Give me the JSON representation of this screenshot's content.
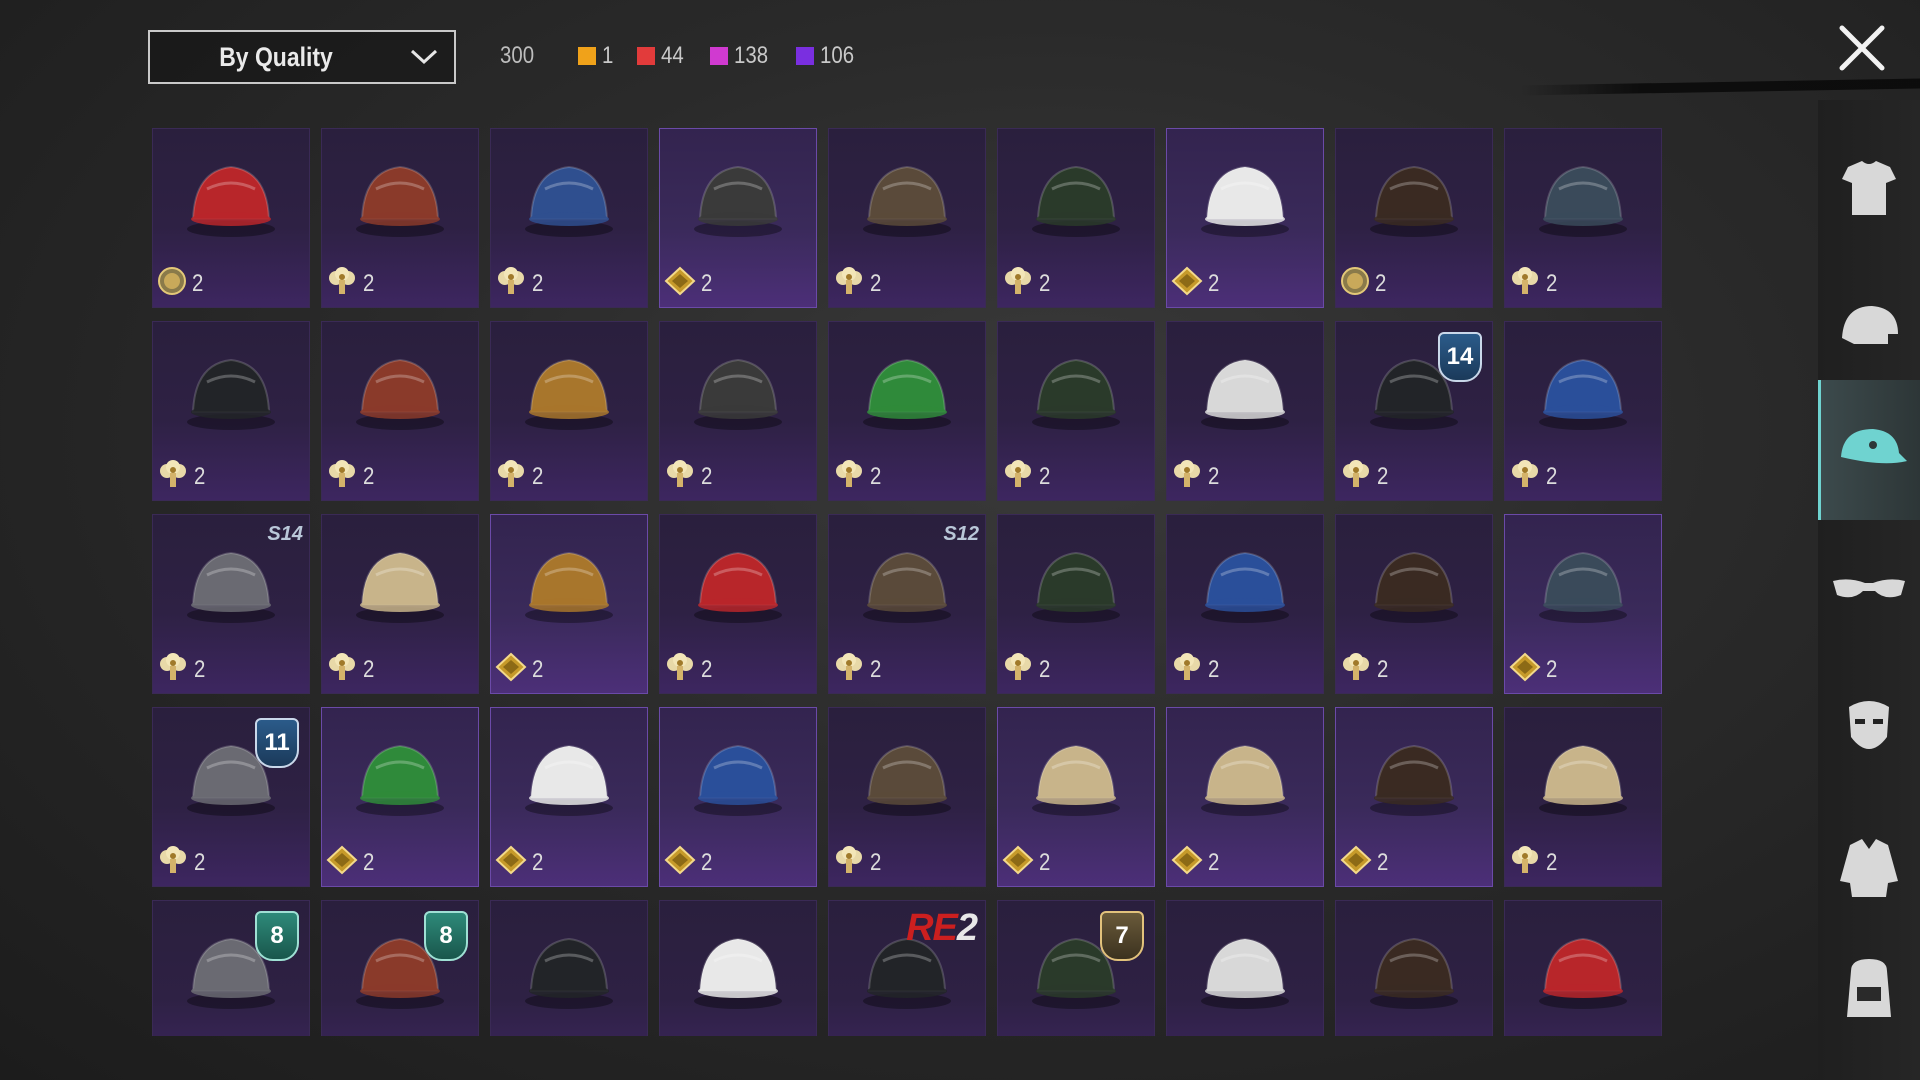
{
  "toolbar": {
    "sort_label": "By Quality",
    "total_count": "300",
    "quality_counts": [
      {
        "color": "#f0a21a",
        "count": "1"
      },
      {
        "color": "#e23b3b",
        "count": "44"
      },
      {
        "color": "#d03ad0",
        "count": "138"
      },
      {
        "color": "#7a2fe0",
        "count": "106"
      }
    ]
  },
  "sidebar": {
    "categories": [
      {
        "icon": "outfit-icon",
        "active": false
      },
      {
        "icon": "helmet-icon",
        "active": false
      },
      {
        "icon": "cap-icon",
        "active": true
      },
      {
        "icon": "glasses-icon",
        "active": false
      },
      {
        "icon": "mask-icon",
        "active": false
      },
      {
        "icon": "jacket-icon",
        "active": false
      },
      {
        "icon": "backpack-icon",
        "active": false
      }
    ]
  },
  "items": [
    {
      "icon": "red-mohawk-icon",
      "currency": "coin",
      "cost": "2",
      "quality": "epic"
    },
    {
      "icon": "football-helmet-icon",
      "currency": "tree",
      "cost": "2",
      "quality": "epic"
    },
    {
      "icon": "cricket-helmet-icon",
      "currency": "tree",
      "cost": "2",
      "quality": "epic"
    },
    {
      "icon": "sombrero-icon",
      "currency": "diamond",
      "cost": "2",
      "quality": "legend"
    },
    {
      "icon": "steampunk-hat-icon",
      "currency": "tree",
      "cost": "2",
      "quality": "epic"
    },
    {
      "icon": "tribal-mask-hair-icon",
      "currency": "tree",
      "cost": "2",
      "quality": "epic"
    },
    {
      "icon": "white-cap-icon",
      "currency": "diamond",
      "cost": "2",
      "quality": "legend"
    },
    {
      "icon": "long-hair-icon",
      "currency": "coin",
      "cost": "2",
      "quality": "epic"
    },
    {
      "icon": "navy-cap-icon",
      "currency": "tree",
      "cost": "2",
      "quality": "epic"
    },
    {
      "icon": "gas-mask-icon",
      "currency": "tree",
      "cost": "2",
      "quality": "epic"
    },
    {
      "icon": "goggles-helmet-icon",
      "currency": "tree",
      "cost": "2",
      "quality": "epic"
    },
    {
      "icon": "beanie-icon",
      "currency": "tree",
      "cost": "2",
      "quality": "epic"
    },
    {
      "icon": "mushroom-hat-icon",
      "currency": "tree",
      "cost": "2",
      "quality": "epic"
    },
    {
      "icon": "green-hair-icon",
      "currency": "tree",
      "cost": "2",
      "quality": "epic"
    },
    {
      "icon": "bun-hair-icon",
      "currency": "tree",
      "cost": "2",
      "quality": "epic"
    },
    {
      "icon": "clown-mask-icon",
      "currency": "tree",
      "cost": "2",
      "quality": "epic"
    },
    {
      "icon": "police-cap-icon",
      "currency": "tree",
      "cost": "2",
      "quality": "epic",
      "badge": "14",
      "badge_style": "shield blue"
    },
    {
      "icon": "yellow-blue-helmet-icon",
      "currency": "tree",
      "cost": "2",
      "quality": "epic"
    },
    {
      "icon": "spartan-helmet-icon",
      "currency": "tree",
      "cost": "2",
      "quality": "epic",
      "badge": "S14",
      "badge_style": "s"
    },
    {
      "icon": "cowboy-hat-icon",
      "currency": "tree",
      "cost": "2",
      "quality": "epic"
    },
    {
      "icon": "turban-icon",
      "currency": "diamond",
      "cost": "2",
      "quality": "legend"
    },
    {
      "icon": "pink-cap-icon",
      "currency": "tree",
      "cost": "2",
      "quality": "epic"
    },
    {
      "icon": "pilot-helmet-icon",
      "currency": "tree",
      "cost": "2",
      "quality": "epic",
      "badge": "S12",
      "badge_style": "s"
    },
    {
      "icon": "bunny-ears-icon",
      "currency": "tree",
      "cost": "2",
      "quality": "epic"
    },
    {
      "icon": "blue-beanie-icon",
      "currency": "tree",
      "cost": "2",
      "quality": "epic"
    },
    {
      "icon": "hooded-mask-icon",
      "currency": "tree",
      "cost": "2",
      "quality": "epic"
    },
    {
      "icon": "knit-hat-icon",
      "currency": "diamond",
      "cost": "2",
      "quality": "legend"
    },
    {
      "icon": "bucket-hat-icon",
      "currency": "tree",
      "cost": "2",
      "quality": "epic",
      "badge": "11",
      "badge_style": "shield blue"
    },
    {
      "icon": "green-wig-icon",
      "currency": "diamond",
      "cost": "2",
      "quality": "legend"
    },
    {
      "icon": "white-turban-icon",
      "currency": "diamond",
      "cost": "2",
      "quality": "legend"
    },
    {
      "icon": "blue-turban-icon",
      "currency": "diamond",
      "cost": "2",
      "quality": "legend"
    },
    {
      "icon": "cat-headphones-icon",
      "currency": "tree",
      "cost": "2",
      "quality": "epic"
    },
    {
      "icon": "pith-helmet-icon",
      "currency": "diamond",
      "cost": "2",
      "quality": "legend"
    },
    {
      "icon": "straw-hat-icon",
      "currency": "diamond",
      "cost": "2",
      "quality": "legend"
    },
    {
      "icon": "steel-helmet-icon",
      "currency": "diamond",
      "cost": "2",
      "quality": "legend"
    },
    {
      "icon": "yellow-pith-helmet-icon",
      "currency": "tree",
      "cost": "2",
      "quality": "epic"
    },
    {
      "icon": "camo-boonie-icon",
      "currency": "tree",
      "cost": "",
      "quality": "epic",
      "badge": "8",
      "badge_style": "shield green"
    },
    {
      "icon": "beret-icon",
      "currency": "tree",
      "cost": "",
      "quality": "epic",
      "badge": "8",
      "badge_style": "shield green"
    },
    {
      "icon": "anubis-mask-icon",
      "currency": "tree",
      "cost": "",
      "quality": "epic"
    },
    {
      "icon": "white-cat-headphones-icon",
      "currency": "tree",
      "cost": "",
      "quality": "epic"
    },
    {
      "icon": "black-cap-icon",
      "currency": "tree",
      "cost": "",
      "quality": "epic",
      "badge_re": "RE",
      "badge_two": "2",
      "badge_style": "re2"
    },
    {
      "icon": "tank-helmet-icon",
      "currency": "tree",
      "cost": "",
      "quality": "epic",
      "badge": "7",
      "badge_style": "shield gold"
    },
    {
      "icon": "winter-hat-icon",
      "currency": "tree",
      "cost": "",
      "quality": "epic"
    },
    {
      "icon": "feather-hat-icon",
      "currency": "tree",
      "cost": "",
      "quality": "epic"
    },
    {
      "icon": "red-bandana-cap-icon",
      "currency": "tree",
      "cost": "",
      "quality": "epic"
    }
  ]
}
